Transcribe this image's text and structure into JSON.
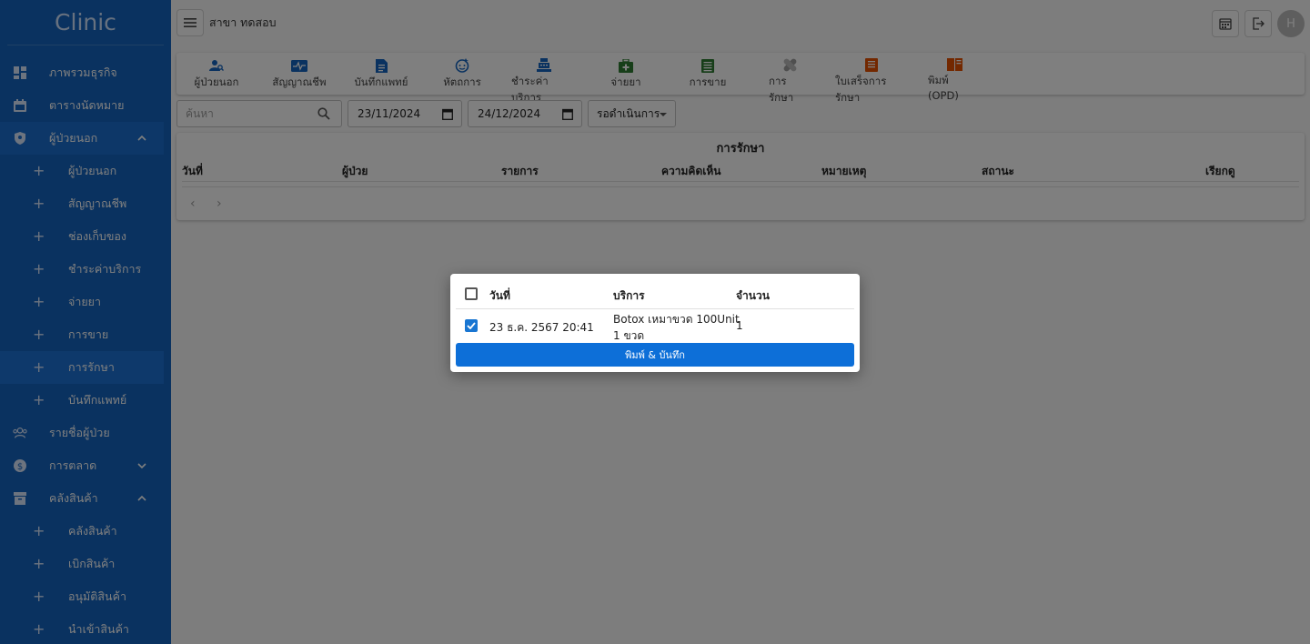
{
  "app": {
    "logo": "Clinic"
  },
  "sidebar": {
    "items": [
      {
        "label": "ภาพรวมธุรกิจ",
        "icon": "dashboard-icon"
      },
      {
        "label": "ตารางนัดหมาย",
        "icon": "calendar-icon"
      },
      {
        "label": "ผู้ป่วยนอก",
        "icon": "shield-icon",
        "expanded": true
      },
      {
        "label": "รายชื่อผู้ป่วย",
        "icon": "people-icon"
      },
      {
        "label": "การตลาด",
        "icon": "dollar-icon",
        "expanded": false
      },
      {
        "label": "คลังสินค้า",
        "icon": "archive-icon",
        "expanded": true
      }
    ],
    "opd_sub": [
      "ผู้ป่วยนอก",
      "สัญญาณชีพ",
      "ช่องเก็บของ",
      "ชำระค่าบริการ",
      "จ่ายยา",
      "การขาย",
      "การรักษา",
      "บันทึกแพทย์"
    ],
    "stock_sub": [
      "คลังสินค้า",
      "เบิกสินค้า",
      "อนุมัติสินค้า",
      "นำเข้าสินค้า"
    ],
    "selected_sub": "การรักษา"
  },
  "header": {
    "branch": "สาขา ทดสอบ",
    "avatar_initial": "H"
  },
  "menu": [
    {
      "label": "ผู้ป่วยนอก",
      "icon": "person-search-icon",
      "color": "#1565c0"
    },
    {
      "label": "สัญญาณชีพ",
      "icon": "monitor-heart-icon",
      "color": "#1565c0"
    },
    {
      "label": "บันทึกแพทย์",
      "icon": "document-icon",
      "color": "#1565c0"
    },
    {
      "label": "หัตถการ",
      "icon": "face-icon",
      "color": "#1565c0"
    },
    {
      "label": "ชำระค่าบริการ",
      "icon": "cash-register-icon",
      "color": "#1565c0"
    },
    {
      "label": "จ่ายยา",
      "icon": "medical-bag-icon",
      "color": "#2e7d32"
    },
    {
      "label": "การขาย",
      "icon": "sheet-icon",
      "color": "#2e7d32"
    },
    {
      "label": "การรักษา",
      "icon": "bandage-icon",
      "color": "#9e9e9e"
    },
    {
      "label": "ใบเสร็จการรักษา",
      "icon": "receipt-icon",
      "color": "#e65100"
    },
    {
      "label": "พิมพ์ (OPD)",
      "icon": "book-icon",
      "color": "#e65100"
    }
  ],
  "filters": {
    "search_placeholder": "ค้นหา",
    "date_from": "23/11/2024",
    "date_to": "24/12/2024",
    "status": "รอดำเนินการ"
  },
  "table": {
    "title": "การรักษา",
    "columns": [
      "วันที่",
      "ผู้ป่วย",
      "รายการ",
      "ความคิดเห็น",
      "หมายเหตุ",
      "สถานะ",
      "เรียกดู"
    ]
  },
  "modal": {
    "columns": [
      "วันที่",
      "บริการ",
      "จำนวน"
    ],
    "rows": [
      {
        "checked": true,
        "date": "23 ธ.ค. 2567 20:41",
        "service_line1": "Botox เหมาขวด 100Unit",
        "service_line2": "1 ขวด",
        "qty": "1"
      }
    ],
    "button": "พิมพ์ & บันทึก"
  }
}
